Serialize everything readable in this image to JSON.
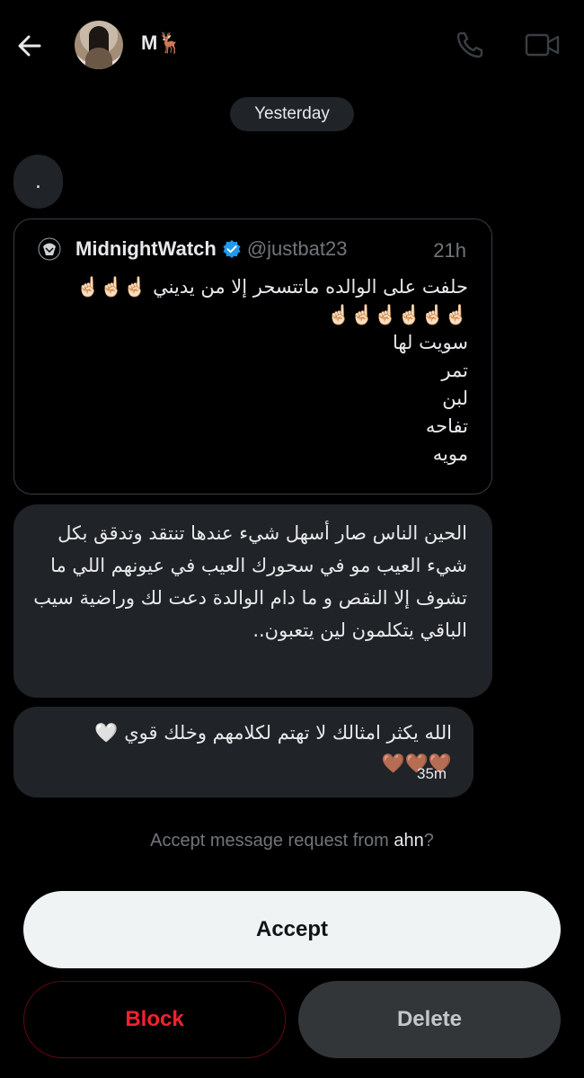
{
  "header": {
    "back_icon": "arrow-left-icon",
    "contact_name": "M🦌",
    "phone_icon": "phone-icon",
    "video_icon": "video-camera-icon"
  },
  "date_separator": "Yesterday",
  "messages": {
    "dot": ".",
    "quoted_post": {
      "author_name": "MidnightWatch",
      "verified_icon": "verified-badge-icon",
      "handle": "@justbat23",
      "time": "21h",
      "text": "حلفت على الوالده ماتتسحر إلا من يديني ☝🏻☝🏻☝🏻\n☝🏻☝🏻☝🏻☝🏻☝🏻☝🏻\nسويت لها\nتمر\nلبن\nتفاحه\nمويه"
    },
    "reply_1": "الحين الناس صار أسهل شيء عندها تنتقد وتدقق بكل شيء العيب مو في سحورك العيب في عيونهم اللي ما تشوف إلا النقص و ما دام الوالدة دعت لك وراضية سيب الباقي يتكلمون لين يتعبون..",
    "reply_2": "الله يكثر امثالك لا تهتم لكلامهم وخلك قوي 🤍\n🤎🤎🤎",
    "reply_2_time": "35m"
  },
  "request": {
    "prefix": "Accept message request from ",
    "handle_visible": "ahn",
    "suffix": "?"
  },
  "actions": {
    "accept": "Accept",
    "block": "Block",
    "delete": "Delete"
  },
  "colors": {
    "background": "#000000",
    "bubble": "#202327",
    "accept_bg": "#eff3f4",
    "block_text": "#f4212e",
    "delete_bg": "#333639",
    "verified": "#1d9bf0"
  }
}
